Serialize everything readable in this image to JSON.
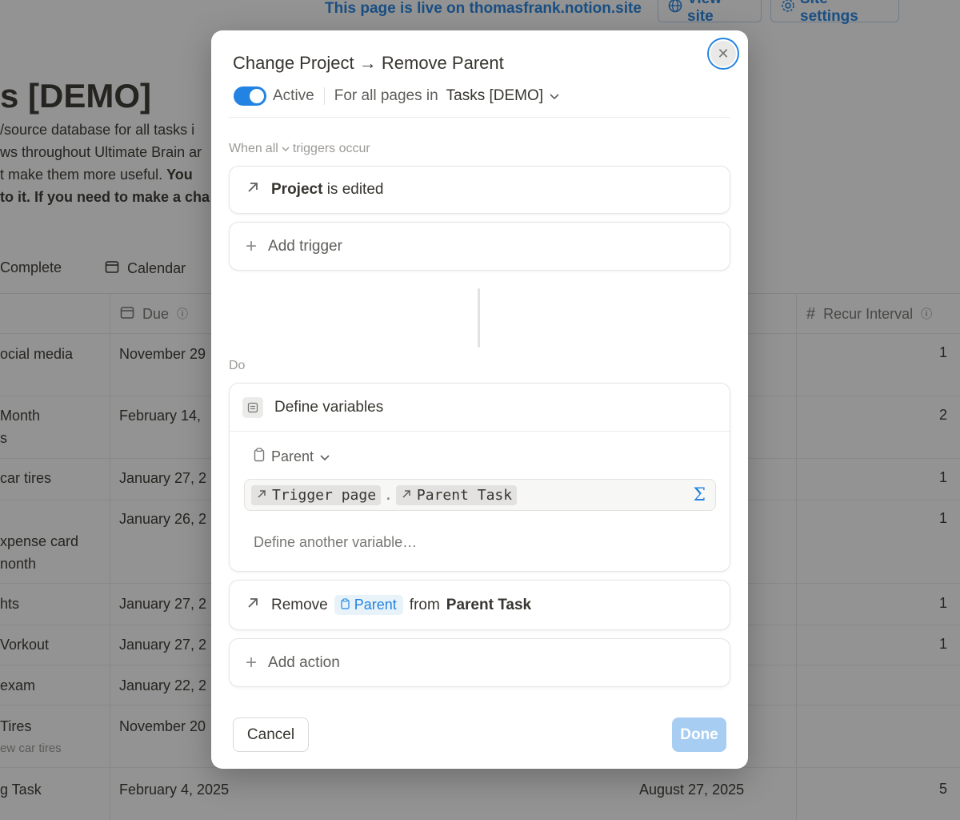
{
  "background": {
    "live_text": "This page is live on thomasfrank.notion.site",
    "view_site": "View site",
    "site_settings": "Site settings",
    "title": "s [DEMO]",
    "desc_lines": [
      "/source database for all tasks i",
      "ws throughout Ultimate Brain ar",
      "t make them more useful. ",
      "to it. If you need to make a cha"
    ],
    "desc_bold_3": "You",
    "tabs": [
      "Complete",
      "Calendar"
    ],
    "col_due": "Due",
    "col_recur": "Recur Interval",
    "rows": [
      {
        "name": "ocial media",
        "due": "November 29",
        "recur": "1"
      },
      {
        "name": "Month",
        "name2": "s",
        "due": "February 14,",
        "recur": "2"
      },
      {
        "name": "car tires",
        "due": "January 27, 2",
        "recur": "1"
      },
      {
        "name": "xpense card",
        "name2": "nonth",
        "due": "January 26, 2",
        "recur": "1"
      },
      {
        "name": "hts",
        "due": "January 27, 2",
        "recur": "1"
      },
      {
        "name": "Vorkout",
        "due": "January 27, 2",
        "recur": "1"
      },
      {
        "name": "exam",
        "due": "January 22, 2",
        "recur": ""
      },
      {
        "name": "Tires",
        "sub": "ew car tires",
        "due": "November 20",
        "recur": ""
      },
      {
        "name": "g Task",
        "due": "February 4, 2025",
        "extra": "August 27, 2025",
        "recur": "5"
      }
    ]
  },
  "modal": {
    "title": "Change Project → Remove Parent",
    "active_label": "Active",
    "scope_prefix": "For all pages in",
    "scope_db": "Tasks [DEMO]",
    "when_prefix": "When",
    "when_mode": "all",
    "when_suffix": "triggers occur",
    "trigger_bold": "Project",
    "trigger_rest": "is edited",
    "add_trigger": "Add trigger",
    "do_label": "Do",
    "define_variables": "Define variables",
    "variable_name": "Parent",
    "formula_token1": "Trigger page",
    "formula_token2": "Parent Task",
    "define_another": "Define another variable…",
    "action_verb": "Remove",
    "action_pill": "Parent",
    "action_from": "from",
    "action_target": "Parent Task",
    "add_action": "Add action",
    "cancel": "Cancel",
    "done": "Done"
  },
  "colors": {
    "accent": "#2383e2",
    "done_disabled": "#a7cdf2"
  }
}
